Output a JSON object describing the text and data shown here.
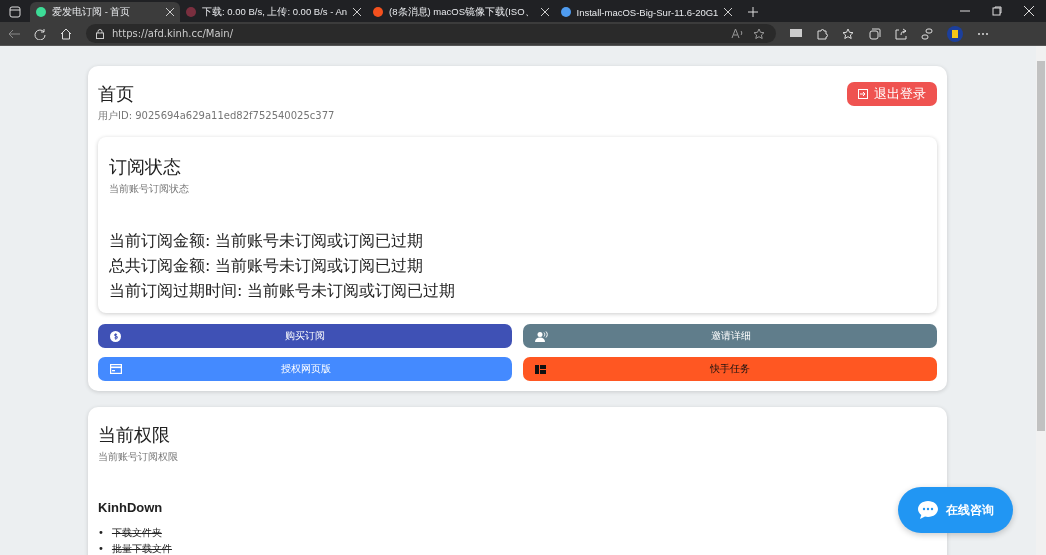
{
  "browser": {
    "tabs": [
      {
        "title": "爱发电订阅 - 首页",
        "selected": true,
        "color": "#3ddc97"
      },
      {
        "title": "下载: 0.00 B/s, 上传: 0.00 B/s - An",
        "selected": false,
        "color": "#7a2f3f"
      },
      {
        "title": "(8条消息) macOS镜像下载(ISO、",
        "selected": false,
        "color": "#f4511e"
      },
      {
        "title": "Install-macOS-Big-Sur-11.6-20G1",
        "selected": false,
        "color": "#4f9cf0"
      }
    ],
    "address": "https://afd.kinh.cc/Main/"
  },
  "header": {
    "title": "首页",
    "user_id": "用户ID: 9025694a629a11ed82f752540025c377",
    "logout": "退出登录"
  },
  "subscription": {
    "title": "订阅状态",
    "subtitle": "当前账号订阅状态",
    "lines": [
      "当前订阅金额: 当前账号未订阅或订阅已过期",
      "总共订阅金额: 当前账号未订阅或订阅已过期",
      "当前订阅过期时间: 当前账号未订阅或订阅已过期"
    ]
  },
  "actions": [
    {
      "label": "购买订阅",
      "kind": "coin",
      "color": "#3f51b5"
    },
    {
      "label": "邀请详细",
      "kind": "invite",
      "color": "#607d8b"
    },
    {
      "label": "授权网页版",
      "kind": "card",
      "color": "#448aff"
    },
    {
      "label": "快手任务",
      "kind": "grid",
      "color": "#ff5722"
    }
  ],
  "permissions": {
    "title": "当前权限",
    "subtitle": "当前账号订阅权限",
    "product": "KinhDown",
    "features": [
      {
        "bullet": "•",
        "label": "下载文件夹",
        "available": false
      },
      {
        "bullet": "•",
        "label": "批量下载文件",
        "available": false
      }
    ]
  },
  "chat_button": "在线咨询"
}
